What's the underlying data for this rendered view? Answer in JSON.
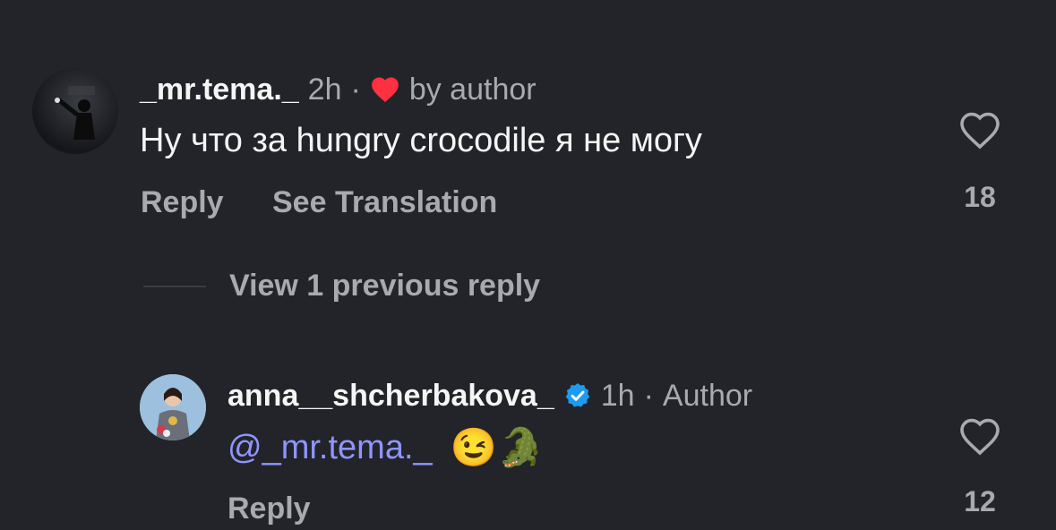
{
  "comments": [
    {
      "username": "_mr.tema._",
      "time": "2h",
      "separator": "·",
      "liked_by_author_text": "by author",
      "text": "Ну что за hungry crocodile я не могу",
      "reply_label": "Reply",
      "translate_label": "See Translation",
      "like_count": "18"
    }
  ],
  "view_replies_label": "View 1 previous reply",
  "reply": {
    "username": "anna__shcherbakova_",
    "time": "1h",
    "separator": "·",
    "author_label": "Author",
    "mention": "@_mr.tema._",
    "emojis": "😉🐊",
    "reply_label": "Reply",
    "like_count": "12"
  },
  "colors": {
    "background": "#222429",
    "secondary_text": "#a8aaad",
    "mention": "#8f95ff",
    "heart_red": "#ff3040",
    "verified_blue": "#1d9bf0"
  }
}
